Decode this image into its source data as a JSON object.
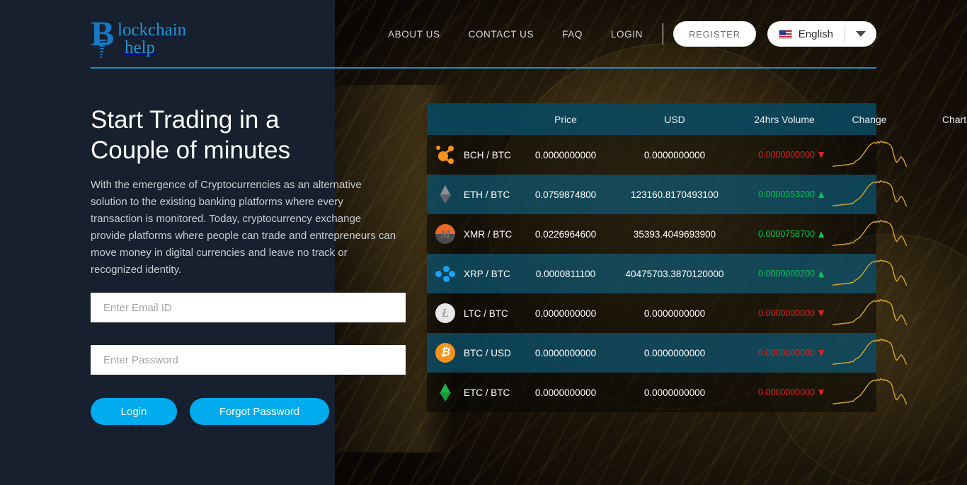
{
  "brand": {
    "line1": "lockchain",
    "line2": "help",
    "initial": "B",
    "accent_color": "#1f8bcf"
  },
  "nav": {
    "links": [
      {
        "label": "ABOUT US",
        "name": "nav-about-us"
      },
      {
        "label": "CONTACT US",
        "name": "nav-contact-us"
      },
      {
        "label": "FAQ",
        "name": "nav-faq"
      },
      {
        "label": "LOGIN",
        "name": "nav-login"
      }
    ],
    "register_label": "REGISTER",
    "language": {
      "label": "English",
      "flag": "us-flag-icon",
      "caret": "chevron-down-icon"
    }
  },
  "hero": {
    "title": "Start Trading in a Couple of minutes",
    "paragraph": "With the emergence of Cryptocurrencies as an alternative solution to the existing banking platforms where every transaction is monitored. Today, cryptocurrency exchange provide platforms where people can trade and entrepreneurs can move money in digital currencies and leave no track or recognized identity."
  },
  "form": {
    "email_placeholder": "Enter Email ID",
    "email_value": "",
    "password_placeholder": "Enter Password",
    "password_value": "",
    "login_label": "Login",
    "forgot_label": "Forgot Password",
    "button_color": "#00acee"
  },
  "market": {
    "columns": [
      "Price",
      "USD",
      "24hrs Volume",
      "Change",
      "Chart"
    ],
    "up_color": "#00c853",
    "down_color": "#e32020",
    "rows": [
      {
        "icon": "bch-icon",
        "pair": "BCH / BTC",
        "usd": "0.0000000000",
        "volume": "0.0000000000",
        "change": "0.0000000000",
        "direction": "down",
        "chart": "sparkline"
      },
      {
        "icon": "eth-icon",
        "pair": "ETH / BTC",
        "usd": "0.0759874800",
        "volume": "123160.8170493100",
        "change": "0.0000353200",
        "direction": "up",
        "chart": "sparkline"
      },
      {
        "icon": "xmr-icon",
        "pair": "XMR / BTC",
        "usd": "0.0226964600",
        "volume": "35393.4049693900",
        "change": "0.0000758700",
        "direction": "up",
        "chart": "sparkline"
      },
      {
        "icon": "xrp-icon",
        "pair": "XRP / BTC",
        "usd": "0.0000811100",
        "volume": "40475703.3870120000",
        "change": "0.0000000200",
        "direction": "up",
        "chart": "sparkline"
      },
      {
        "icon": "ltc-icon",
        "pair": "LTC / BTC",
        "usd": "0.0000000000",
        "volume": "0.0000000000",
        "change": "0.0000000000",
        "direction": "down",
        "chart": "sparkline"
      },
      {
        "icon": "btc-icon",
        "pair": "BTC / USD",
        "usd": "0.0000000000",
        "volume": "0.0000000000",
        "change": "0.0000000000",
        "direction": "down",
        "chart": "sparkline"
      },
      {
        "icon": "etc-icon",
        "pair": "ETC / BTC",
        "usd": "0.0000000000",
        "volume": "0.0000000000",
        "change": "0.0000000000",
        "direction": "down",
        "chart": "sparkline"
      }
    ]
  },
  "chart_data": {
    "type": "line",
    "title": "",
    "xlabel": "",
    "ylabel": "",
    "series": [
      {
        "name": "sparkline",
        "color": "#d4a72c",
        "values": [
          14,
          13,
          15,
          14,
          16,
          15,
          17,
          16,
          18,
          17,
          19,
          18,
          20,
          22,
          21,
          26,
          30,
          33,
          36,
          40,
          46,
          52,
          58,
          66,
          72,
          78,
          82,
          86,
          88,
          90,
          87,
          92,
          88,
          94,
          90,
          92,
          88,
          90,
          86,
          84,
          80,
          70,
          50,
          34,
          26,
          30,
          38,
          44,
          40,
          32,
          20,
          12
        ]
      }
    ],
    "ylim": [
      0,
      100
    ],
    "grid": false,
    "legend": false
  }
}
